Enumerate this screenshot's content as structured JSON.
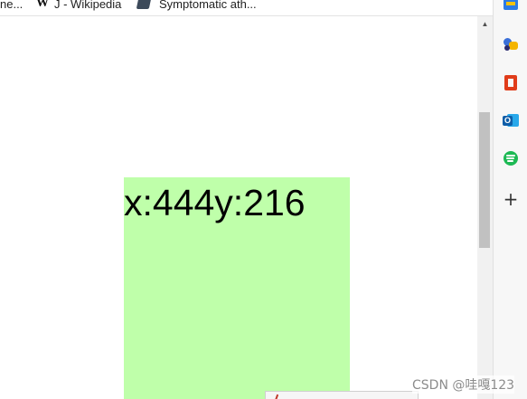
{
  "bookmarks": [
    {
      "label": "ne...",
      "icon": "bookmark-page-icon"
    },
    {
      "label": "J - Wikipedia",
      "icon": "wikipedia-w-icon",
      "icon_glyph": "W"
    },
    {
      "label": "Symptomatic ath...",
      "icon": "document-favicon-icon"
    }
  ],
  "page": {
    "coordinates_text": "x:444y:216",
    "box_color": "#bfffaa"
  },
  "sidebar": {
    "items": [
      {
        "name": "shopping-icon"
      },
      {
        "name": "games-icon"
      },
      {
        "name": "office-icon"
      },
      {
        "name": "outlook-icon",
        "glyph": "O"
      },
      {
        "name": "spotify-icon"
      },
      {
        "name": "add-icon",
        "glyph": "+"
      }
    ]
  },
  "scrollbar": {
    "up_arrow": "▲"
  },
  "watermark": {
    "text": "CSDN @哇嘎123"
  }
}
